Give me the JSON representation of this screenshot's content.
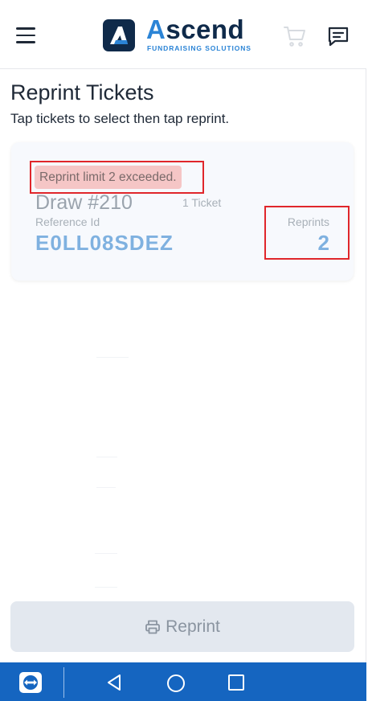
{
  "header": {
    "logo_word_accent": "A",
    "logo_word_rest": "scend",
    "logo_tagline": "FUNDRAISING SOLUTIONS",
    "icons": [
      "menu-icon",
      "cart-icon",
      "chat-icon"
    ]
  },
  "page": {
    "title": "Reprint Tickets",
    "subtitle": "Tap tickets to select then tap reprint."
  },
  "ticket": {
    "limit_message": "Reprint limit 2 exceeded.",
    "draw": "Draw #210",
    "ticket_count": "1 Ticket",
    "reference_label": "Reference Id",
    "reference_id": "E0LL08SDEZ",
    "reprints_label": "Reprints",
    "reprints_value": "2"
  },
  "actions": {
    "reprint_label": "Reprint",
    "reprint_icon": "printer-icon"
  },
  "android_nav": {
    "icons": [
      "teamviewer-icon",
      "back-icon",
      "home-icon",
      "recents-icon"
    ]
  },
  "colors": {
    "brand_navy": "#0f2a4a",
    "brand_blue": "#2b84d6",
    "nav_bar": "#1565c0",
    "highlight_red": "#e0262b"
  }
}
